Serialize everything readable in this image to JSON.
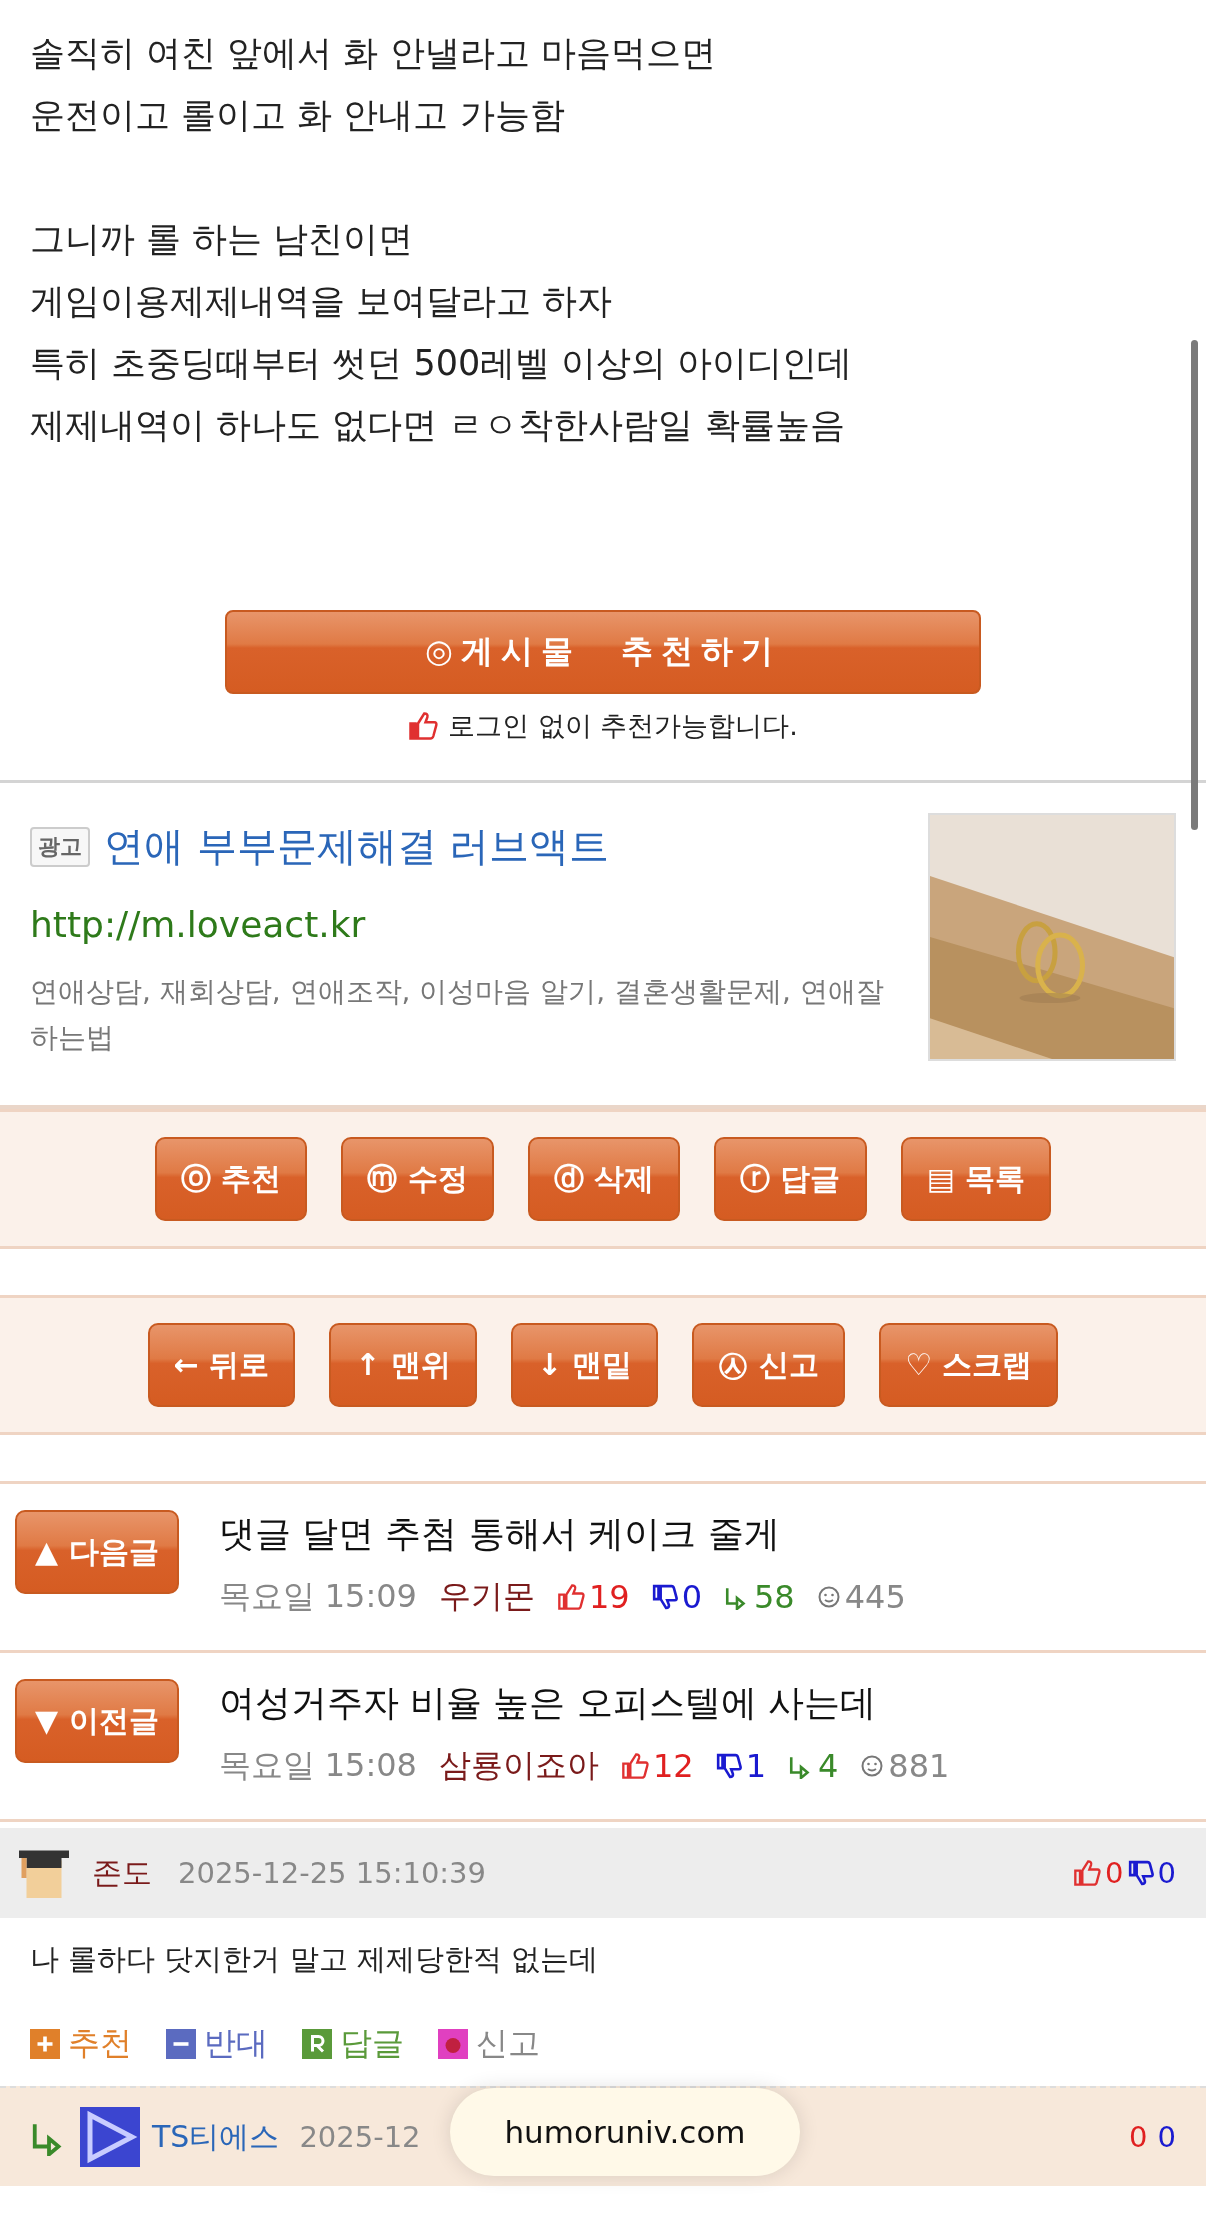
{
  "post_body": {
    "paragraphs": [
      [
        "솔직히 여친 앞에서 화 안낼라고 마음먹으면",
        "운전이고 롤이고 화 안내고 가능함"
      ],
      [
        "그니까 롤 하는 남친이면",
        "게임이용제제내역을 보여달라고 하자",
        "특히 초중딩때부터 썻던 500레벨 이상의 아이디인데",
        "제제내역이 하나도 없다면 ㄹㅇ착한사람일 확률높음"
      ]
    ]
  },
  "recommend": {
    "button": "◎게시물　추천하기",
    "note": "로그인 없이 추천가능합니다."
  },
  "ad": {
    "badge": "광고",
    "title": "연애 부부문제해결 러브액트",
    "url": "http://m.loveact.kr",
    "description": "연애상담, 재회상담, 연애조작, 이성마음 알기, 결혼생활문제, 연애잘하는법"
  },
  "action_rows": [
    [
      "ⓞ 추천",
      "ⓜ 수정",
      "ⓓ 삭제",
      "ⓡ 답글",
      "▤ 목록"
    ],
    [
      "← 뒤로",
      "↑ 맨위",
      "↓ 맨밑",
      "㉦ 신고",
      "♡ 스크랩"
    ]
  ],
  "nav_posts": [
    {
      "button": "▲ 다음글",
      "title": "댓글 달면 추첨 통해서 케이크 줄게",
      "day": "목요일 15:09",
      "author": "우기몬",
      "likes": "19",
      "dislikes": "0",
      "replies": "58",
      "views": "445"
    },
    {
      "button": "▼ 이전글",
      "title": "여성거주자 비율 높은 오피스텔에 사는데",
      "day": "목요일 15:08",
      "author": "삼룡이죠아",
      "likes": "12",
      "dislikes": "1",
      "replies": "4",
      "views": "881"
    }
  ],
  "comments": [
    {
      "kind": "comment",
      "author": "존도",
      "date": "2025-12-25 15:10:39",
      "likes": "0",
      "dislikes": "0",
      "text": "나 롤하다 닷지한거 말고 제제당한적 없는데",
      "actions": [
        {
          "kind": "plus",
          "label": "추천"
        },
        {
          "kind": "minus",
          "label": "반대"
        },
        {
          "kind": "reply",
          "label": "답글"
        },
        {
          "kind": "report",
          "label": "신고"
        }
      ]
    },
    {
      "kind": "reply",
      "author": "TS티에스",
      "date": "2025-12",
      "likes": "0",
      "dislikes": "0"
    }
  ],
  "address_bar": {
    "domain": "humoruniv.com"
  }
}
